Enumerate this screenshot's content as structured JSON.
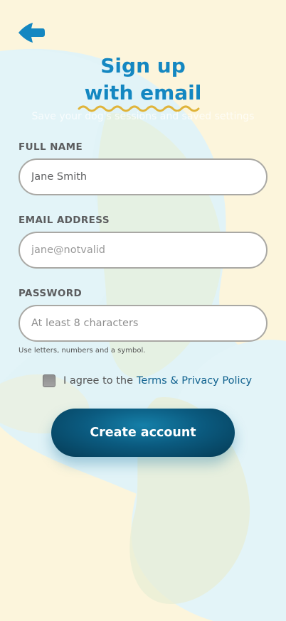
{
  "header": {
    "back_icon": "arrow-left-icon",
    "title_line1": "Sign up",
    "title_line2": "with email",
    "subtitle": "Save your dog's sessions and saved settings"
  },
  "form": {
    "full_name": {
      "label": "FULL NAME",
      "value": "Jane Smith",
      "placeholder": ""
    },
    "email": {
      "label": "EMAIL ADDRESS",
      "value": "jane@notvalid",
      "placeholder": ""
    },
    "password": {
      "label": "PASSWORD",
      "value": "",
      "placeholder": "At least 8 characters",
      "hint": "Use letters, numbers and a symbol."
    },
    "agree": {
      "checked": false,
      "prefix": "I agree to the",
      "link_label": "Terms & Privacy Policy"
    },
    "submit_label": "Create account"
  },
  "colors": {
    "accent": "#1487c1",
    "button_dark": "#0b5b80",
    "link": "#11628f",
    "background": "#fcf5dc",
    "squiggle": "#e0b43a"
  }
}
